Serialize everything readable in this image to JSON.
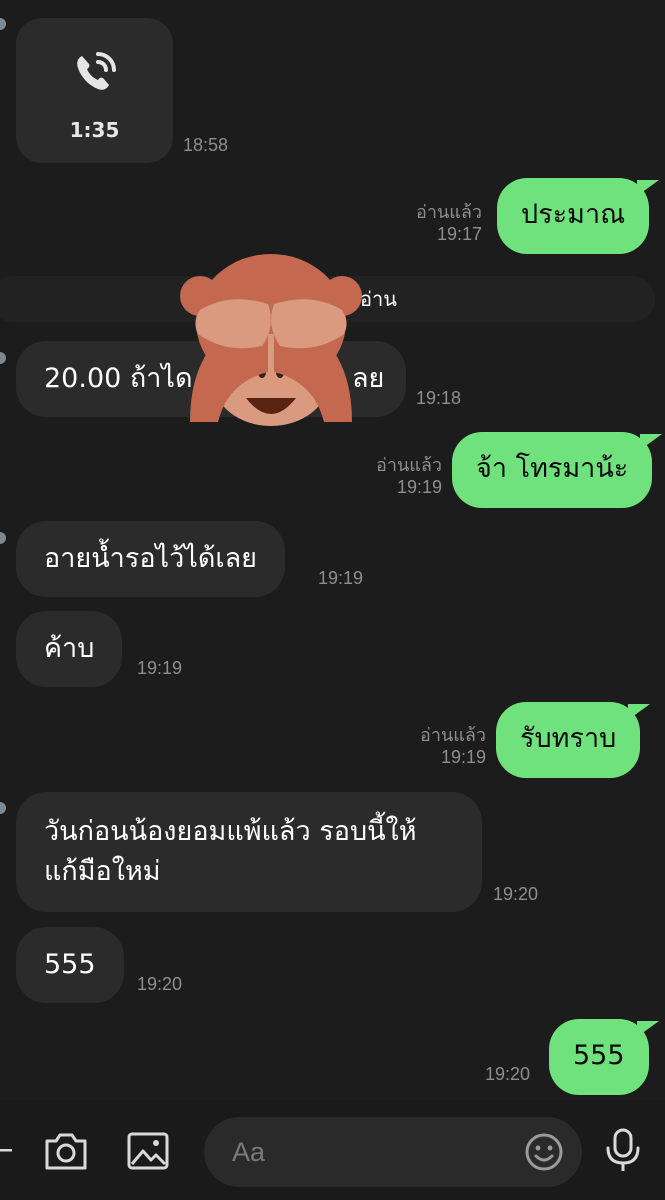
{
  "call": {
    "duration": "1:35",
    "time": "18:58"
  },
  "notice": {
    "text": "อ่าน"
  },
  "messages": [
    {
      "text": "ประมาณ",
      "read": "อ่านแล้ว",
      "time": "19:17"
    },
    {
      "text": "20.00 ถ้าได",
      "text_end": "ลย",
      "time": "19:18"
    },
    {
      "text": "จ้า โทรมาน้ะ",
      "read": "อ่านแล้ว",
      "time": "19:19"
    },
    {
      "text": "อายน้ำรอไว้ได้เลย",
      "time": "19:19"
    },
    {
      "text": "ค้าบ",
      "time": "19:19"
    },
    {
      "text": "รับทราบ",
      "read": "อ่านแล้ว",
      "time": "19:19"
    },
    {
      "line1": "วันก่อนน้องยอมแพ้แล้ว รอบนี้ให้",
      "line2": "แก้มือใหม่",
      "time": "19:20"
    },
    {
      "text": "555",
      "time": "19:20"
    },
    {
      "text": "555",
      "time": "19:20"
    }
  ],
  "input": {
    "placeholder": "Aa"
  },
  "colors": {
    "background": "#1c1c1c",
    "incoming": "#2b2b2b",
    "outgoing": "#6fe27d",
    "meta": "#8e8e8e"
  },
  "icons": [
    "phone-call-icon",
    "monkey-see-no-evil-sticker",
    "plus-icon",
    "camera-icon",
    "image-icon",
    "emoji-icon",
    "microphone-icon"
  ]
}
